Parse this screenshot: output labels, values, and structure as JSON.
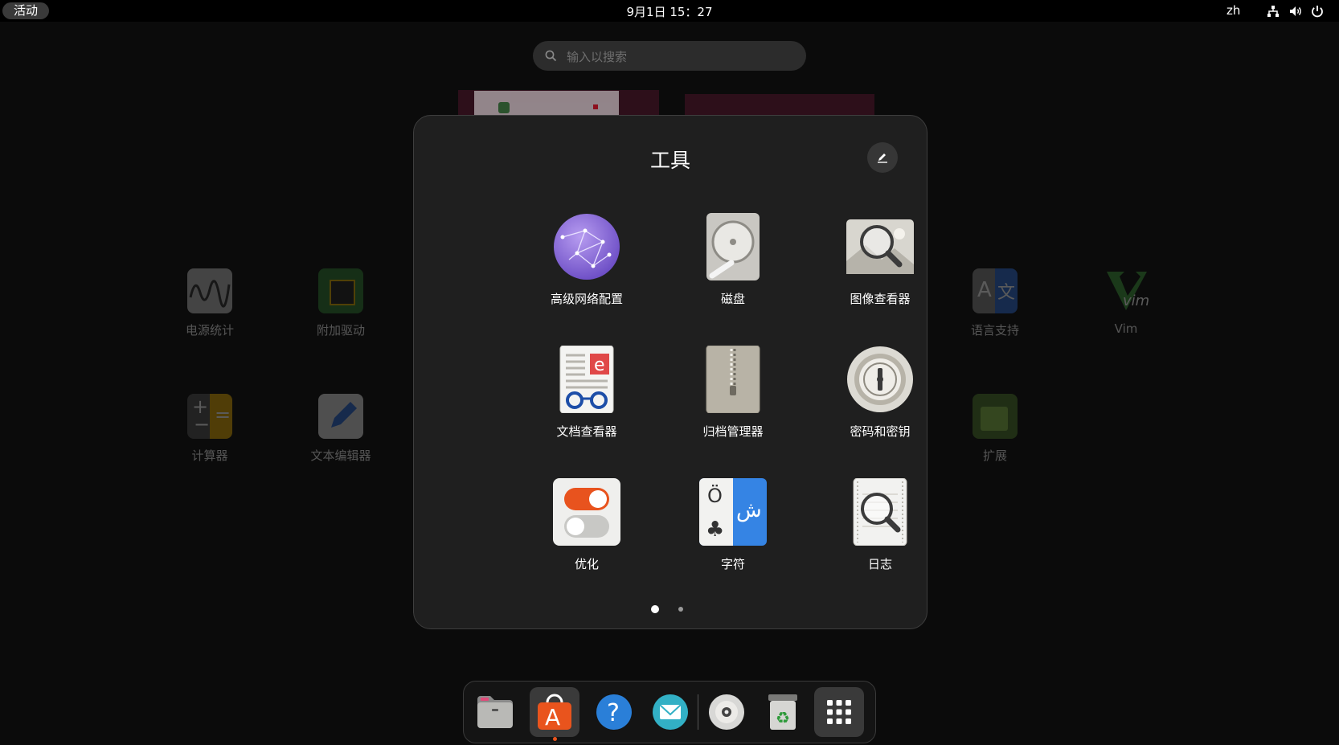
{
  "topbar": {
    "activities_label": "活动",
    "clock": "9月1日  15：27",
    "input_language": "zh",
    "status_icons": [
      "network-icon",
      "volume-icon",
      "power-icon"
    ]
  },
  "search": {
    "placeholder": "输入以搜索"
  },
  "background_apps": [
    {
      "label": "电源统计",
      "icon": "power-statistics-icon"
    },
    {
      "label": "附加驱动",
      "icon": "additional-drivers-icon"
    },
    {
      "label": "语言支持",
      "icon": "language-support-icon"
    },
    {
      "label": "Vim",
      "icon": "vim-icon"
    },
    {
      "label": "计算器",
      "icon": "calculator-icon"
    },
    {
      "label": "文本编辑器",
      "icon": "text-editor-icon"
    },
    {
      "label": "扩展",
      "icon": "extensions-icon"
    }
  ],
  "folder": {
    "title": "工具",
    "rename_icon": "edit-icon",
    "apps": [
      {
        "label": "高级网络配置",
        "icon": "network-connections-icon"
      },
      {
        "label": "磁盘",
        "icon": "disks-icon"
      },
      {
        "label": "图像查看器",
        "icon": "image-viewer-icon"
      },
      {
        "label": "文档查看器",
        "icon": "document-viewer-icon"
      },
      {
        "label": "归档管理器",
        "icon": "archive-manager-icon"
      },
      {
        "label": "密码和密钥",
        "icon": "passwords-keys-icon"
      },
      {
        "label": "优化",
        "icon": "tweaks-icon"
      },
      {
        "label": "字符",
        "icon": "characters-icon"
      },
      {
        "label": "日志",
        "icon": "logs-icon"
      }
    ],
    "pages": {
      "count": 2,
      "current": 1
    }
  },
  "dock": {
    "items": [
      {
        "name": "files",
        "icon": "files-icon",
        "running": false
      },
      {
        "name": "app-center",
        "icon": "app-center-icon",
        "running": true
      },
      {
        "name": "help",
        "icon": "help-icon",
        "running": false
      },
      {
        "name": "mail",
        "icon": "mail-icon",
        "running": false
      },
      {
        "name": "disc",
        "icon": "disc-icon",
        "running": false
      },
      {
        "name": "trash",
        "icon": "trash-icon",
        "running": false
      },
      {
        "name": "show-apps",
        "icon": "app-grid-icon",
        "running": false
      }
    ],
    "running_indicator_color": "#e9541d"
  },
  "colors": {
    "accent": "#e9541d",
    "panel": "#1f1f1f",
    "background": "#0b0b0b"
  }
}
